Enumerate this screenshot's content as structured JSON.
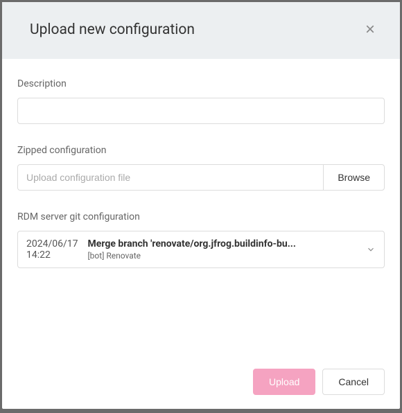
{
  "modal": {
    "title": "Upload new configuration",
    "close_label": "×"
  },
  "form": {
    "description": {
      "label": "Description",
      "value": ""
    },
    "zipped_config": {
      "label": "Zipped configuration",
      "placeholder": "Upload configuration file",
      "value": "",
      "browse_label": "Browse"
    },
    "git_config": {
      "label": "RDM server git configuration",
      "timestamp_date": "2024/06/17",
      "timestamp_time": "14:22",
      "commit_message": "Merge branch 'renovate/org.jfrog.buildinfo-bu...",
      "author": "[bot] Renovate"
    }
  },
  "footer": {
    "upload_label": "Upload",
    "cancel_label": "Cancel"
  }
}
